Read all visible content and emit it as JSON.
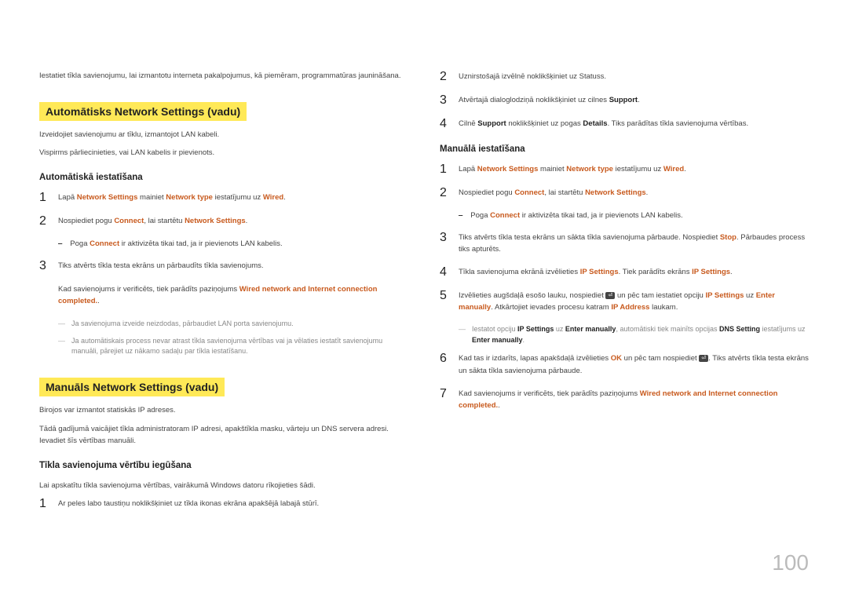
{
  "left": {
    "intro": "Iestatiet tīkla savienojumu, lai izmantotu interneta pakalpojumus, kā piemēram, programmatūras jaunināšana.",
    "h1": "Automātisks Network Settings (vadu)",
    "h1_p1": "Izveidojiet savienojumu ar tīklu, izmantojot LAN kabeli.",
    "h1_p2": "Vispirms pārliecinieties, vai LAN kabelis ir pievienots.",
    "sub1": "Automātiskā iestatīšana",
    "s1_pre": "Lapā ",
    "s1_a1": "Network Settings",
    "s1_mid": " mainiet ",
    "s1_a2": "Network type",
    "s1_mid2": " iestatījumu uz ",
    "s1_a3": "Wired",
    "s1_end": ".",
    "s2_pre": "Nospiediet pogu ",
    "s2_a1": "Connect",
    "s2_mid": ", lai startētu ",
    "s2_a2": "Network Settings",
    "s2_end": ".",
    "s2_dash_pre": "Poga ",
    "s2_dash_a1": "Connect",
    "s2_dash_end": " ir aktivizēta tikai tad, ja ir pievienots LAN kabelis.",
    "s3": "Tiks atvērts tīkla testa ekrāns un pārbaudīts tīkla savienojums.",
    "s3_b_pre": "Kad savienojums ir verificēts, tiek parādīts paziņojums ",
    "s3_b_a": "Wired network and Internet connection completed.",
    "s3_b_end": ".",
    "n1": "Ja savienojuma izveide neizdodas, pārbaudiet LAN porta savienojumu.",
    "n2": "Ja automātiskais process nevar atrast tīkla savienojuma vērtības vai ja vēlaties iestatīt savienojumu manuāli, pārejiet uz nākamo sadaļu par tīkla iestatīšanu.",
    "h2": "Manuāls Network Settings (vadu)",
    "h2_p1": "Birojos var izmantot statiskās IP adreses.",
    "h2_p2": "Tādā gadījumā vaicājiet tīkla administratoram IP adresi, apakštīkla masku, vārteju un DNS servera adresi. Ievadiet šīs vērtības manuāli.",
    "sub2": "Tīkla savienojuma vērtību iegūšana",
    "sub2_p": "Lai apskatītu tīkla savienojuma vērtības, vairākumā Windows datoru rīkojieties šādi.",
    "l_s1": "Ar peles labo taustiņu noklikšķiniet uz tīkla ikonas ekrāna apakšējā labajā stūrī."
  },
  "right": {
    "r_s2": "Uznirstošajā izvēlnē noklikšķiniet uz Statuss.",
    "r_s3_pre": "Atvērtajā dialoglodziņā noklikšķiniet uz cilnes ",
    "r_s3_b": "Support",
    "r_s3_end": ".",
    "r_s4_pre": "Cilnē ",
    "r_s4_b1": "Support",
    "r_s4_mid": " noklikšķiniet uz pogas ",
    "r_s4_b2": "Details",
    "r_s4_end": ". Tiks parādītas tīkla savienojuma vērtības.",
    "sub3": "Manuālā iestatīšana",
    "m1_pre": "Lapā ",
    "m1_a1": "Network Settings",
    "m1_mid": " mainiet ",
    "m1_a2": "Network type",
    "m1_mid2": " iestatījumu uz ",
    "m1_a3": "Wired",
    "m1_end": ".",
    "m2_pre": "Nospiediet pogu ",
    "m2_a1": "Connect",
    "m2_mid": ", lai startētu ",
    "m2_a2": "Network Settings",
    "m2_end": ".",
    "m2_dash_pre": "Poga ",
    "m2_dash_a1": "Connect",
    "m2_dash_end": " ir aktivizēta tikai tad, ja ir pievienots LAN kabelis.",
    "m3_pre": "Tiks atvērts tīkla testa ekrāns un sākta tīkla savienojuma pārbaude. Nospiediet ",
    "m3_a1": "Stop",
    "m3_end": ". Pārbaudes process tiks apturēts.",
    "m4_pre": "Tīkla savienojuma ekrānā izvēlieties ",
    "m4_a1": "IP Settings",
    "m4_mid": ". Tiek parādīts ekrāns ",
    "m4_a2": "IP Settings",
    "m4_end": ".",
    "m5_pre": "Izvēlieties augšdaļā esošo lauku, nospiediet ",
    "m5_mid1": " un pēc tam iestatiet opciju ",
    "m5_a1": "IP Settings",
    "m5_mid2": " uz ",
    "m5_a2": "Enter manually",
    "m5_mid3": ". Atkārtojiet ievades procesu katram ",
    "m5_a3": "IP Address",
    "m5_end": " laukam.",
    "m5_note_pre": "Iestatot opciju ",
    "m5_note_a1": "IP Settings",
    "m5_note_mid1": " uz ",
    "m5_note_a2": "Enter manually",
    "m5_note_mid2": ", automātiski tiek mainīts opcijas ",
    "m5_note_a3": "DNS Setting",
    "m5_note_mid3": " iestatījums uz ",
    "m5_note_a4": "Enter manually",
    "m5_note_end": ".",
    "m6_pre": "Kad tas ir izdarīts, lapas apakšdaļā izvēlieties ",
    "m6_a1": "OK",
    "m6_mid": " un pēc tam nospiediet ",
    "m6_end": ". Tiks atvērts tīkla testa ekrāns un sākta tīkla savienojuma pārbaude.",
    "m7_pre": "Kad savienojums ir verificēts, tiek parādīts paziņojums ",
    "m7_a1": "Wired network and Internet connection completed.",
    "m7_end": "."
  },
  "pagenum": "100"
}
